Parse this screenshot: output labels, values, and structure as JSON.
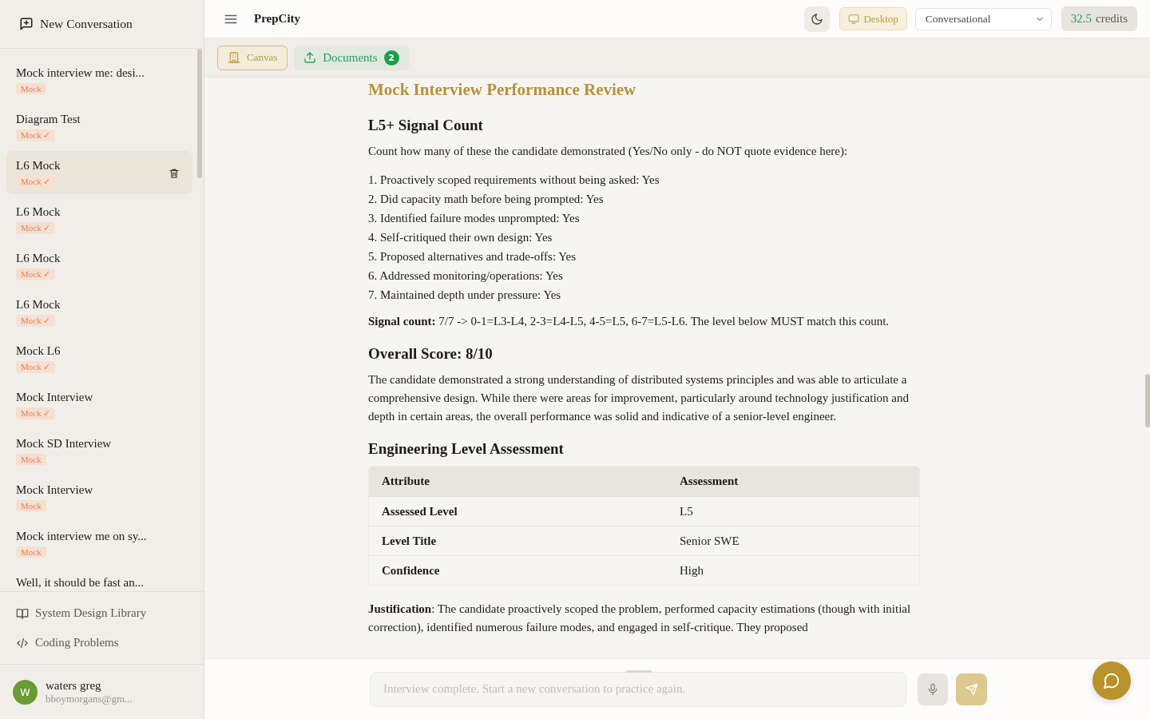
{
  "sidebar": {
    "new_conversation": "New Conversation",
    "conversations": [
      {
        "title": "Mock interview me: desi...",
        "badge": "Mock",
        "selected": false
      },
      {
        "title": "Diagram Test",
        "badge": "Mock ✓",
        "selected": false
      },
      {
        "title": "L6 Mock",
        "badge": "Mock ✓",
        "selected": true
      },
      {
        "title": "L6 Mock",
        "badge": "Mock ✓",
        "selected": false
      },
      {
        "title": "L6 Mock",
        "badge": "Mock ✓",
        "selected": false
      },
      {
        "title": "L6 Mock",
        "badge": "Mock ✓",
        "selected": false
      },
      {
        "title": "Mock L6",
        "badge": "Mock ✓",
        "selected": false
      },
      {
        "title": "Mock Interview",
        "badge": "Mock ✓",
        "selected": false
      },
      {
        "title": "Mock SD Interview",
        "badge": "Mock",
        "selected": false
      },
      {
        "title": "Mock Interview",
        "badge": "Mock",
        "selected": false
      },
      {
        "title": "Mock interview me on sy...",
        "badge": "Mock",
        "selected": false
      },
      {
        "title": "Well, it should be fast an...",
        "selected": false
      }
    ],
    "links": [
      {
        "label": "System Design Library",
        "kind": "book"
      },
      {
        "label": "Coding Problems",
        "kind": "code"
      }
    ],
    "user": {
      "initial": "W",
      "name": "waters greg",
      "email": "bboymorgans@gm..."
    }
  },
  "topbar": {
    "app_name": "PrepCity",
    "view_button": "Desktop",
    "mode_select": "Conversational",
    "credits": {
      "amount": "32.5",
      "label": "credits"
    }
  },
  "toolbar": {
    "buttons": [
      {
        "label": "Canvas",
        "kind": "canvas"
      },
      {
        "label": "Documents",
        "kind": "documents",
        "count": "2"
      }
    ]
  },
  "document": {
    "blocks": [
      {
        "kind": "title",
        "text": "Mock Interview Performance Review"
      },
      {
        "kind": "heading",
        "text": "L5+ Signal Count"
      },
      {
        "kind": "paragraph",
        "text": "Count how many of these the candidate demonstrated (Yes/No only - do NOT quote evidence here):"
      },
      {
        "kind": "list",
        "items": [
          "1. Proactively scoped requirements without being asked: Yes",
          "2. Did capacity math before being prompted: Yes",
          "3. Identified failure modes unprompted: Yes",
          "4. Self-critiqued their own design: Yes",
          "5. Proposed alternatives and trade-offs: Yes",
          "6. Addressed monitoring/operations: Yes",
          "7. Maintained depth under pressure: Yes"
        ]
      },
      {
        "kind": "paragraph",
        "text": "**Signal count:** 7/7 -> 0-1=L3-L4, 2-3=L4-L5, 4-5=L5, 6-7=L5-L6. The level below MUST match this count."
      },
      {
        "kind": "heading",
        "text": "Overall Score: 8/10"
      },
      {
        "kind": "paragraph",
        "text": "The candidate demonstrated a strong understanding of distributed systems principles and was able to articulate a comprehensive design. While there were areas for improvement, particularly around technology justification and depth in certain areas, the overall performance was solid and indicative of a senior-level engineer."
      },
      {
        "kind": "heading",
        "text": "Engineering Level Assessment"
      },
      {
        "kind": "table",
        "columns": [
          "Attribute",
          "Assessment"
        ],
        "rows": [
          [
            "Assessed Level",
            "L5"
          ],
          [
            "Level Title",
            "Senior SWE"
          ],
          [
            "Confidence",
            "High"
          ]
        ]
      },
      {
        "kind": "paragraph",
        "text": "**Justification**: The candidate proactively scoped the problem, performed capacity estimations (though with initial correction), identified numerous failure modes, and engaged in self-critique. They proposed"
      }
    ]
  },
  "composer": {
    "placeholder": "Interview complete. Start a new conversation to practice again."
  }
}
